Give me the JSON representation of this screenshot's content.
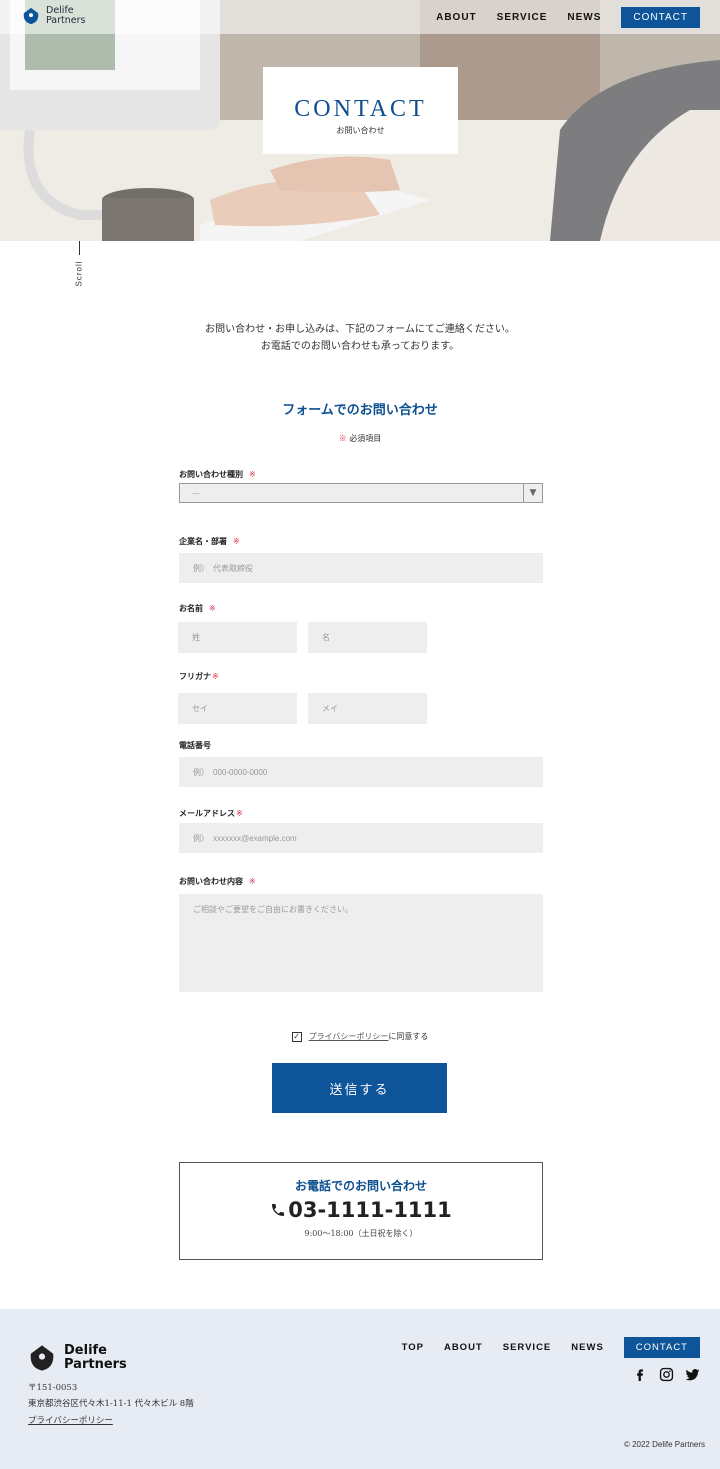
{
  "brand": {
    "name_line1": "Delife",
    "name_line2": "Partners"
  },
  "nav": {
    "about": "ABOUT",
    "service": "SERVICE",
    "news": "NEWS",
    "contact": "CONTACT"
  },
  "hero": {
    "title": "CONTACT",
    "subtitle": "お問い合わせ",
    "scroll": "Scroll"
  },
  "intro": {
    "line1": "お問い合わせ・お申し込みは、下記のフォームにてご連絡ください。",
    "line2": "お電話でのお問い合わせも承っております。"
  },
  "form": {
    "heading": "フォームでのお問い合わせ",
    "required_mark": "※",
    "required_note": "必須項目",
    "inquiry_type": {
      "label": "お問い合わせ種別",
      "value": "—"
    },
    "company": {
      "label": "企業名・部署",
      "placeholder": "例）　代表取締役"
    },
    "name": {
      "label": "お名前",
      "last_placeholder": "姓",
      "first_placeholder": "名"
    },
    "kana": {
      "label": "フリガナ",
      "last_placeholder": "セイ",
      "first_placeholder": "メイ"
    },
    "phone": {
      "label": "電話番号",
      "placeholder": "例）　000-0000-0000"
    },
    "email": {
      "label": "メールアドレス",
      "placeholder": "例）　xxxxxxx@example.com"
    },
    "message": {
      "label": "お問い合わせ内容",
      "placeholder": "ご相談やご要望をご自由にお書きください。"
    },
    "agree": {
      "link": "プライバシーポリシー",
      "text": "に同意する",
      "checked": true
    },
    "submit": "送信する"
  },
  "phone_box": {
    "title": "お電話でのお問い合わせ",
    "number": "03-1111-1111",
    "hours": "9:00〜18:00（土日祝を除く）"
  },
  "footer": {
    "postal": "〒151-0053",
    "address": "東京都渋谷区代々木1-11-1 代々木ビル 8階",
    "privacy": "プライバシーポリシー",
    "nav": {
      "top": "TOP",
      "about": "ABOUT",
      "service": "SERVICE",
      "news": "NEWS",
      "contact": "CONTACT"
    },
    "social": [
      "facebook-icon",
      "instagram-icon",
      "twitter-icon"
    ],
    "copyright": "© 2022 Delife Partners"
  },
  "colors": {
    "accent": "#0d5498",
    "required": "#e0334b",
    "footer_bg": "#e7ecf4",
    "field_bg": "#eeeeee"
  }
}
